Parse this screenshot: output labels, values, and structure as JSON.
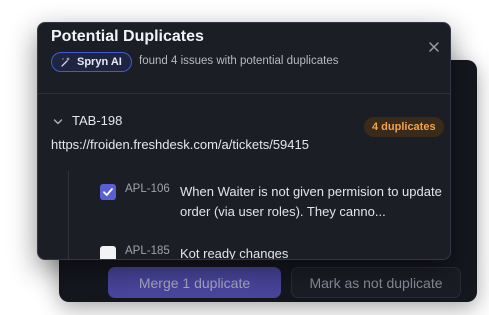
{
  "dialog": {
    "title": "Potential Duplicates",
    "close_icon": "close-icon",
    "ai_badge": {
      "label": "Spryn AI",
      "icon": "sparkle-wand-icon"
    },
    "subtitle": "found 4 issues with potential duplicates"
  },
  "group": {
    "expanded_icon": "chevron-down-icon",
    "key": "TAB-198",
    "url": "https://froiden.freshdesk.com/a/tickets/59415",
    "badge": "4 duplicates",
    "items": [
      {
        "key": "APL-106",
        "text": "When Waiter is not given permision to update order (via user roles). They canno...",
        "checked": true
      },
      {
        "key": "APL-185",
        "text": "Kot ready changes",
        "checked": false
      }
    ]
  },
  "footer": {
    "merge_label": "Merge 1 duplicate",
    "mark_label": "Mark as not duplicate"
  },
  "colors": {
    "accent": "#5b5fd6",
    "badge_orange": "#f1a24b",
    "ai_border": "#3f5bd6",
    "dialog_bg": "#1c1e26"
  }
}
